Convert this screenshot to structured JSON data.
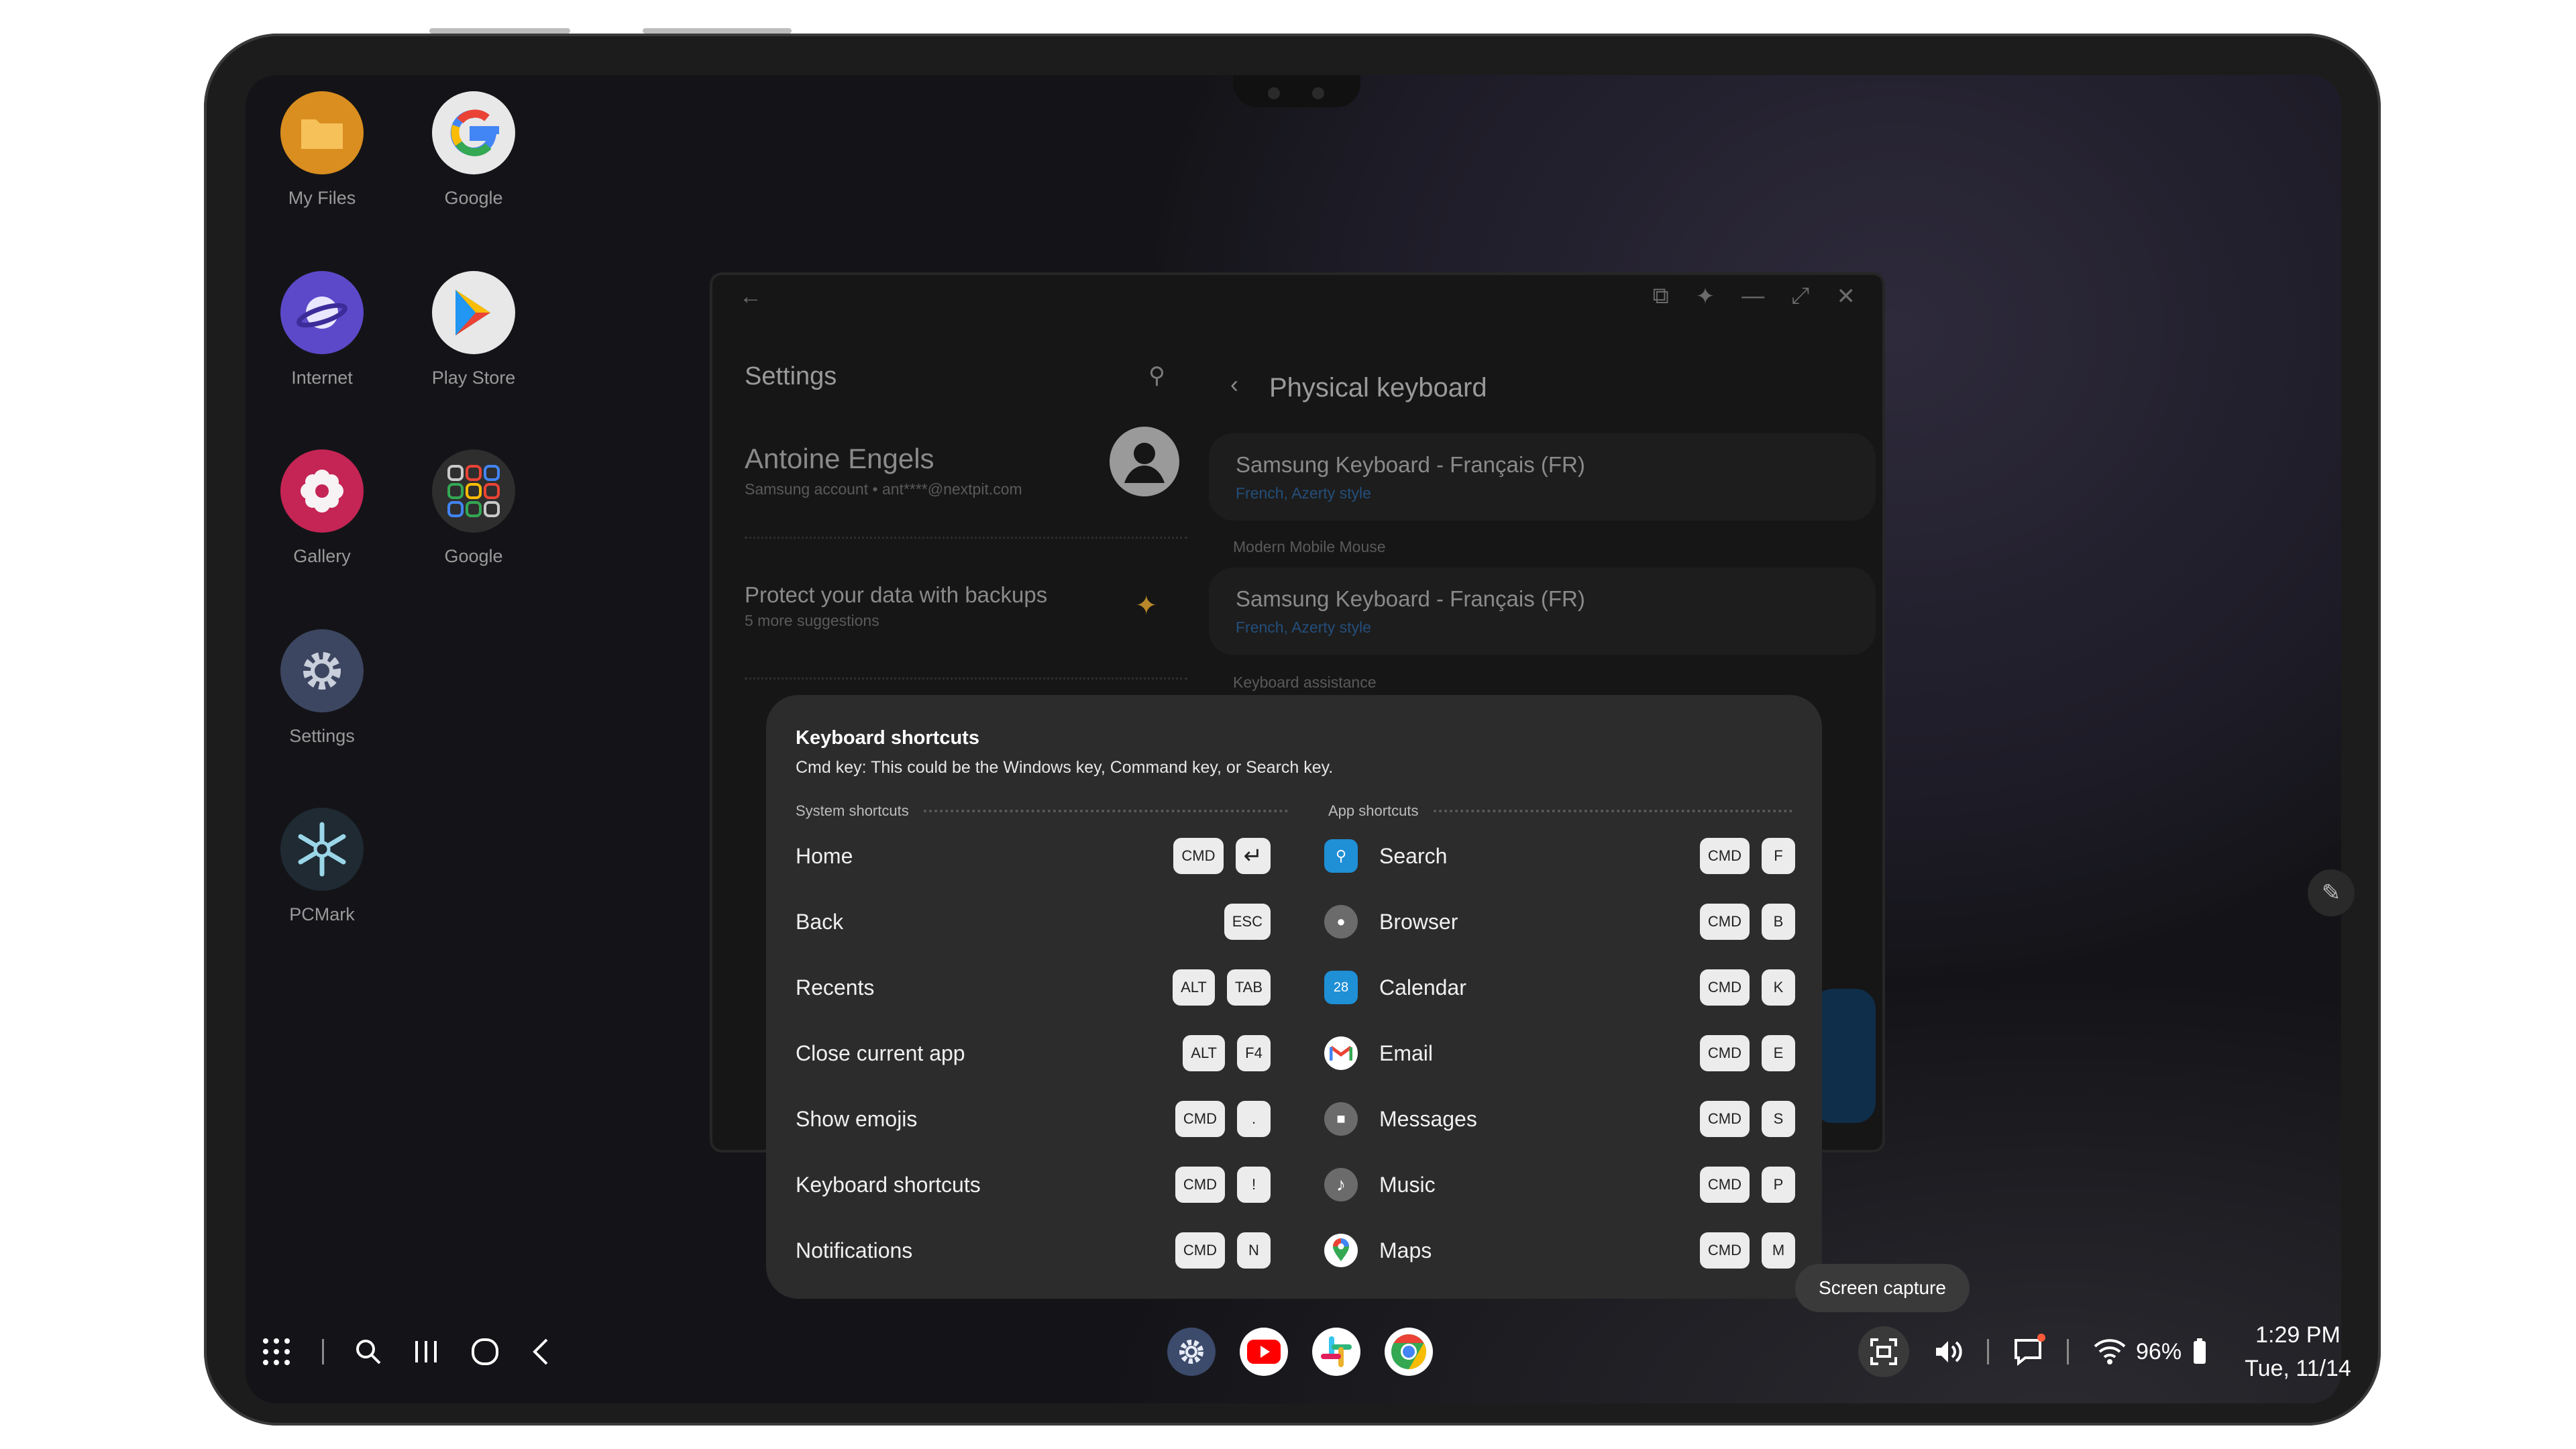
{
  "desktop_apps": [
    {
      "label": "My Files",
      "icon": "folder-icon",
      "color": "#f2a531"
    },
    {
      "label": "Google",
      "icon": "google-g-icon",
      "color": "#ffffff"
    },
    {
      "label": "Internet",
      "icon": "samsung-internet-icon",
      "color": "#6c5ce7"
    },
    {
      "label": "Play Store",
      "icon": "play-store-icon",
      "color": "#ffffff"
    },
    {
      "label": "Gallery",
      "icon": "gallery-flower-icon",
      "color": "#e0356a"
    },
    {
      "label": "Google",
      "icon": "google-folder-icon",
      "color": "#3a3a3a"
    },
    {
      "label": "Settings",
      "icon": "gear-icon",
      "color": "#4a5670"
    },
    {
      "label": "PCMark",
      "icon": "pcmark-snowflake-icon",
      "color": "#2a9ab5"
    }
  ],
  "settings_window": {
    "title": "Settings",
    "account_name": "Antoine Engels",
    "account_sub": "Samsung account  •  ant****@nextpit.com",
    "backup_title": "Protect your data with backups",
    "backup_sub": "5 more suggestions",
    "detail_title": "Physical keyboard",
    "kb1_title": "Samsung Keyboard - Français (FR)",
    "kb1_sub": "French, Azerty style",
    "section_mouse": "Modern Mobile Mouse",
    "kb2_title": "Samsung Keyboard - Français (FR)",
    "kb2_sub": "French, Azerty style",
    "section_assist": "Keyboard assistance"
  },
  "shortcuts": {
    "title": "Keyboard shortcuts",
    "subtitle": "Cmd key: This could be the Windows key, Command key, or Search key.",
    "system_header": "System shortcuts",
    "app_header": "App shortcuts",
    "system": [
      {
        "label": "Home",
        "keys": [
          "CMD",
          "↵"
        ]
      },
      {
        "label": "Back",
        "keys": [
          "ESC"
        ]
      },
      {
        "label": "Recents",
        "keys": [
          "ALT",
          "TAB"
        ]
      },
      {
        "label": "Close current app",
        "keys": [
          "ALT",
          "F4"
        ]
      },
      {
        "label": "Show emojis",
        "keys": [
          "CMD",
          "."
        ]
      },
      {
        "label": "Keyboard shortcuts",
        "keys": [
          "CMD",
          "!"
        ]
      },
      {
        "label": "Notifications",
        "keys": [
          "CMD",
          "N"
        ]
      }
    ],
    "apps": [
      {
        "label": "Search",
        "icon": "search-app-icon",
        "color": "#1f8fd6",
        "keys": [
          "CMD",
          "F"
        ]
      },
      {
        "label": "Browser",
        "icon": "globe-icon",
        "color": "#6b6b6b",
        "keys": [
          "CMD",
          "B"
        ]
      },
      {
        "label": "Calendar",
        "icon": "calendar-icon",
        "color": "#1f8fd6",
        "keys": [
          "CMD",
          "K"
        ]
      },
      {
        "label": "Email",
        "icon": "gmail-icon",
        "color": "#ffffff",
        "keys": [
          "CMD",
          "E"
        ]
      },
      {
        "label": "Messages",
        "icon": "messages-icon",
        "color": "#6b6b6b",
        "keys": [
          "CMD",
          "S"
        ]
      },
      {
        "label": "Music",
        "icon": "music-icon",
        "color": "#6b6b6b",
        "keys": [
          "CMD",
          "P"
        ]
      },
      {
        "label": "Maps",
        "icon": "maps-pin-icon",
        "color": "#ffffff",
        "keys": [
          "CMD",
          "M"
        ]
      }
    ]
  },
  "tooltip": "Screen capture",
  "status": {
    "battery": "96%",
    "time": "1:29 PM",
    "date": "Tue, 11/14"
  },
  "calendar_icon_text": "28"
}
